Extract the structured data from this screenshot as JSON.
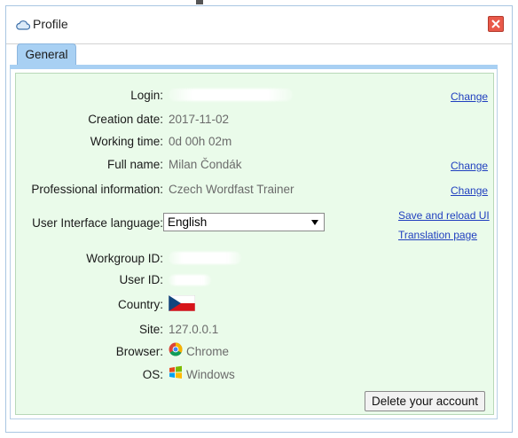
{
  "dialog": {
    "title": "Profile"
  },
  "tabs": [
    {
      "label": "General"
    }
  ],
  "profile": {
    "login_label": "Login:",
    "creation_date_label": "Creation date:",
    "creation_date": "2017-11-02",
    "working_time_label": "Working time:",
    "working_time": "0d 00h 02m",
    "full_name_label": "Full name:",
    "full_name": "Milan Čondák",
    "professional_label": "Professional information:",
    "professional": "Czech Wordfast Trainer",
    "ui_language_label": "User Interface language:",
    "ui_language": "English",
    "workgroup_label": "Workgroup ID:",
    "user_id_label": "User ID:",
    "country_label": "Country:",
    "country_flag": "czech-flag-icon",
    "site_label": "Site:",
    "site": "127.0.0.1",
    "browser_label": "Browser:",
    "browser": "Chrome",
    "browser_icon": "chrome-icon",
    "os_label": "OS:",
    "os": "Windows",
    "os_icon": "windows-icon"
  },
  "links": {
    "change": "Change",
    "save_reload": "Save and reload UI",
    "translation": "Translation page"
  },
  "buttons": {
    "delete_account": "Delete your account"
  },
  "colors": {
    "panel_bg": "#eafbea",
    "tab_bg": "#a8d0f3",
    "link": "#1f3fbf",
    "close_bg": "#e9594a"
  }
}
